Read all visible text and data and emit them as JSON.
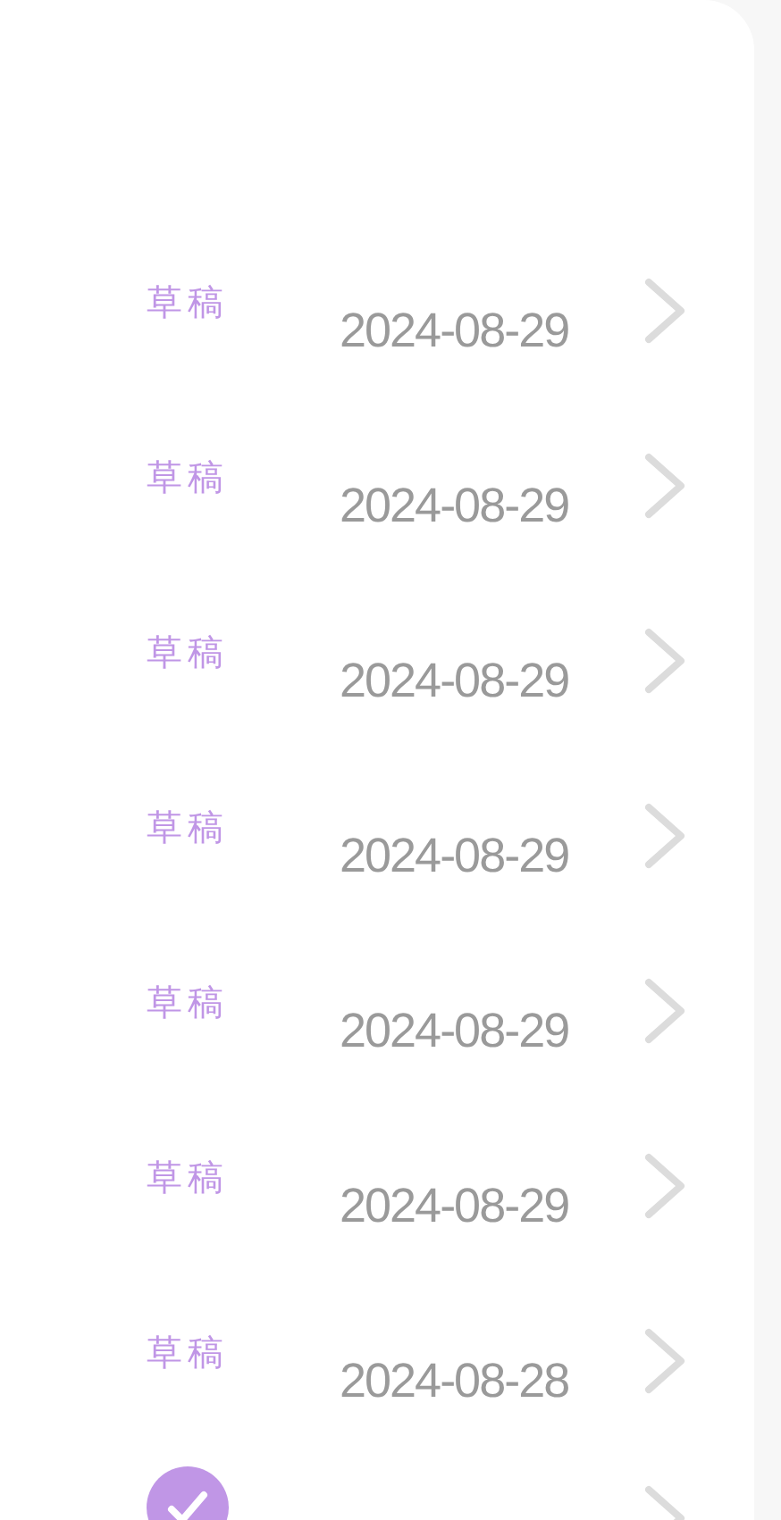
{
  "rows": [
    {
      "kind": "draft",
      "status": "草稿",
      "date": "2024-08-29"
    },
    {
      "kind": "draft",
      "status": "草稿",
      "date": "2024-08-29"
    },
    {
      "kind": "draft",
      "status": "草稿",
      "date": "2024-08-29"
    },
    {
      "kind": "draft",
      "status": "草稿",
      "date": "2024-08-29"
    },
    {
      "kind": "draft",
      "status": "草稿",
      "date": "2024-08-29"
    },
    {
      "kind": "draft",
      "status": "草稿",
      "date": "2024-08-29"
    },
    {
      "kind": "draft",
      "status": "草稿",
      "date": "2024-08-28"
    },
    {
      "kind": "done"
    }
  ]
}
